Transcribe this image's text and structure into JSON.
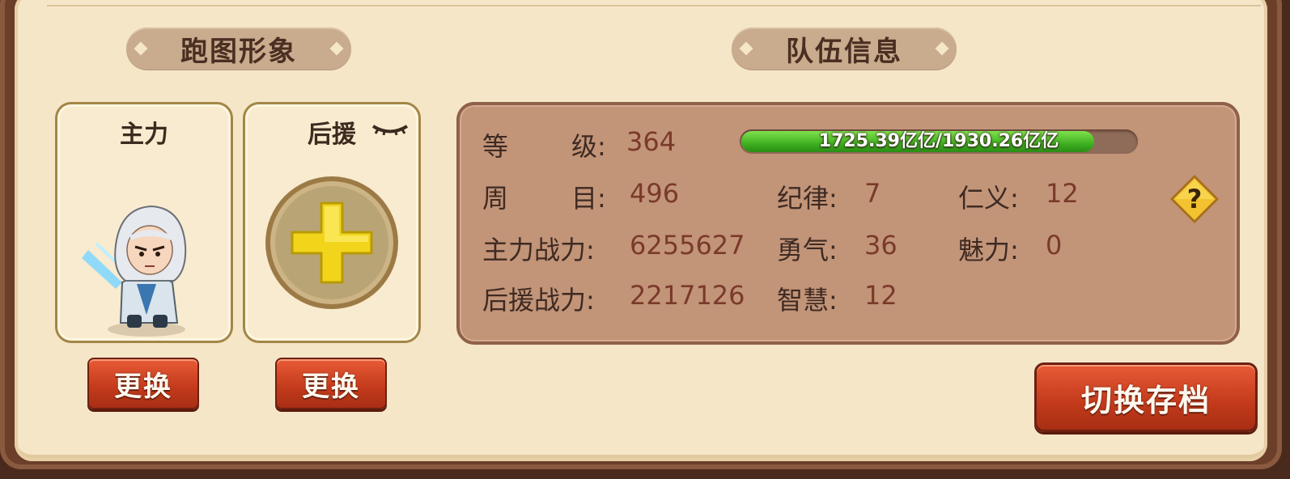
{
  "sections": {
    "avatar_title": "跑图形象",
    "team_title": "队伍信息"
  },
  "cards": {
    "main_label": "主力",
    "support_label": "后援"
  },
  "buttons": {
    "change_main": "更换",
    "change_support": "更换",
    "switch_save": "切换存档"
  },
  "team": {
    "level_label1": "等",
    "level_label2": "级:",
    "level_value": "364",
    "xp_text": "1725.39亿亿/1930.26亿亿",
    "xp_fraction": 0.894,
    "cycle_label1": "周",
    "cycle_label2": "目:",
    "cycle_value": "496",
    "discipline_label": "纪律:",
    "discipline_value": "7",
    "benevolence_label": "仁义:",
    "benevolence_value": "12",
    "main_power_label": "主力战力:",
    "main_power_value": "6255627",
    "courage_label": "勇气:",
    "courage_value": "36",
    "charm_label": "魅力:",
    "charm_value": "0",
    "support_power_label": "后援战力:",
    "support_power_value": "2217126",
    "wisdom_label": "智慧:",
    "wisdom_value": "12"
  },
  "icons": {
    "help": "question-diamond-icon",
    "eye": "eye-closed-icon",
    "plus": "add-plus-icon",
    "hero": "hero-avatar-icon"
  },
  "colors": {
    "button_red": "#c23a1b",
    "xp_green": "#3fb021",
    "info_bg": "#c29478"
  }
}
